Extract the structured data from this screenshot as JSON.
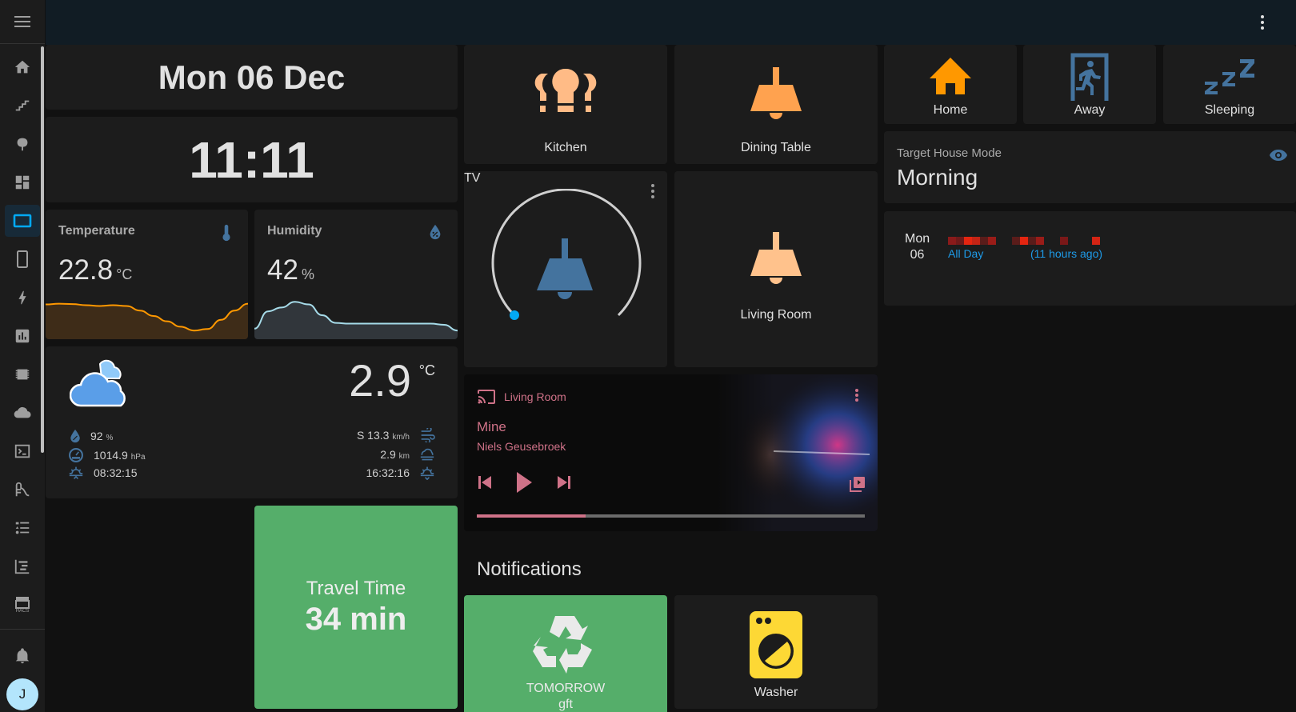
{
  "sidebar": {
    "menu_icon": "menu-icon",
    "items": [
      {
        "name": "home",
        "icon": "home-icon",
        "active": false
      },
      {
        "name": "stairs",
        "icon": "stairs-icon",
        "active": false
      },
      {
        "name": "tree",
        "icon": "tree-icon",
        "active": false
      },
      {
        "name": "dashboard",
        "icon": "view-dashboard-icon",
        "active": false
      },
      {
        "name": "tablet-landscape",
        "icon": "tablet-landscape-icon",
        "active": true
      },
      {
        "name": "phone",
        "icon": "tablet-portrait-icon",
        "active": false
      },
      {
        "name": "energy",
        "icon": "lightning-icon",
        "active": false
      },
      {
        "name": "history",
        "icon": "chart-box-icon",
        "active": false
      },
      {
        "name": "chip",
        "icon": "chip-icon",
        "active": false
      },
      {
        "name": "cloud",
        "icon": "cloud-icon",
        "active": false
      },
      {
        "name": "terminal",
        "icon": "console-icon",
        "active": false
      },
      {
        "name": "pool",
        "icon": "slide-icon",
        "active": false
      },
      {
        "name": "list",
        "icon": "format-list-icon",
        "active": false
      },
      {
        "name": "logbook",
        "icon": "chart-timeline-icon",
        "active": false
      },
      {
        "name": "hacs",
        "icon": "hacs-store-icon",
        "label": "HACS",
        "active": false
      }
    ],
    "notifications_icon": "bell-icon",
    "avatar_initial": "J"
  },
  "header": {
    "overflow_icon": "dots-vertical-icon"
  },
  "date": "Mon 06 Dec",
  "time": "11:11",
  "temperature": {
    "name": "Temperature",
    "value": "22.8",
    "unit": "°C",
    "icon": "thermometer-icon",
    "line_color": "#ff9800",
    "fill_color": "#3e2c18",
    "history": [
      0.78,
      0.8,
      0.79,
      0.76,
      0.74,
      0.76,
      0.74,
      0.62,
      0.48,
      0.34,
      0.2,
      0.1,
      0.14,
      0.38,
      0.62,
      0.8
    ]
  },
  "humidity": {
    "name": "Humidity",
    "value": "42",
    "unit": "%",
    "icon": "water-percent-icon",
    "line_color": "#a6dbe9",
    "fill_color": "#31363b",
    "history": [
      0.15,
      0.6,
      0.7,
      0.85,
      0.78,
      0.5,
      0.3,
      0.28,
      0.28,
      0.28,
      0.28,
      0.28,
      0.28,
      0.28,
      0.25,
      0.1
    ]
  },
  "weather": {
    "condition_icon": "cloudy-icon",
    "temperature": "2.9",
    "unit": "°C",
    "left": [
      {
        "icon": "water-percent-icon",
        "value": "92",
        "unit": "%"
      },
      {
        "icon": "gauge-icon",
        "value": "1014.9",
        "unit": "hPa"
      },
      {
        "icon": "sunrise-icon",
        "value": "08:32:15",
        "unit": ""
      }
    ],
    "right": [
      {
        "icon": "weather-windy-icon",
        "value": "S 13.3",
        "unit": "km/h"
      },
      {
        "icon": "weather-fog-icon",
        "value": "2.9",
        "unit": "km"
      },
      {
        "icon": "sunset-icon",
        "value": "16:32:16",
        "unit": ""
      }
    ]
  },
  "travel": {
    "label": "Travel Time",
    "value": "34 min",
    "color": "#55ae6a"
  },
  "lights": [
    {
      "name": "Kitchen",
      "icon": "lightbulb-group-icon",
      "color": "#ffbb86"
    },
    {
      "name": "Dining Table",
      "icon": "ceiling-light-icon",
      "color": "#ffa24f"
    },
    {
      "name": "TV",
      "icon": "ceiling-light-icon",
      "color": "#44739e",
      "brightness_pct": 0
    },
    {
      "name": "Living Room",
      "icon": "ceiling-light-icon",
      "color": "#ffc28c"
    }
  ],
  "media": {
    "source": "Living Room",
    "title": "Mine",
    "artist": "Niels Geusebroek",
    "progress_pct": 28,
    "accent": "#cf7288",
    "icons": {
      "cast": "cast-icon",
      "prev": "skip-previous-icon",
      "play": "play-icon",
      "next": "skip-next-icon",
      "source": "library-icon",
      "more": "dots-vertical-icon"
    }
  },
  "notifications": {
    "heading": "Notifications",
    "items": [
      {
        "label": "TOMORROW",
        "sublabel": "gft",
        "icon": "recycle-icon",
        "color": "#55ae6a"
      },
      {
        "label": "Washer",
        "icon": "washing-machine-icon",
        "color": "#fdd835"
      }
    ]
  },
  "modes": [
    {
      "label": "Home",
      "icon": "home-icon",
      "color": "#ff9800"
    },
    {
      "label": "Away",
      "icon": "exit-run-icon",
      "color": "#44739e"
    },
    {
      "label": "Sleeping",
      "icon": "sleep-icon",
      "color": "#44739e"
    }
  ],
  "target_mode": {
    "caption": "Target House Mode",
    "value": "Morning",
    "icon": "eye-icon"
  },
  "calendar": {
    "day_name": "Mon",
    "day_num": "06",
    "events": [
      {
        "title": "All Day"
      },
      {
        "title": "(11 hours ago)"
      }
    ]
  }
}
